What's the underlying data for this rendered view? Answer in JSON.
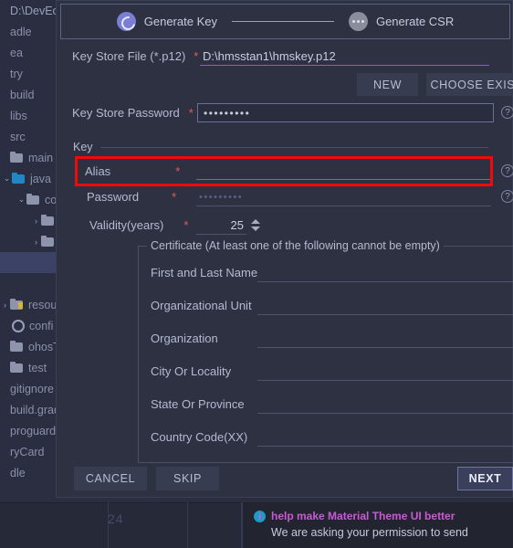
{
  "ide": {
    "tree": [
      {
        "label": "D:\\DevEco",
        "type": "path",
        "indent": 0,
        "arrow": "",
        "selected": false
      },
      {
        "label": "adle",
        "type": "plain",
        "indent": 0,
        "arrow": "",
        "selected": false
      },
      {
        "label": "ea",
        "type": "plain",
        "indent": 0,
        "arrow": "",
        "selected": false
      },
      {
        "label": "try",
        "type": "plain",
        "indent": 0,
        "arrow": "",
        "selected": false
      },
      {
        "label": "build",
        "type": "plain",
        "indent": 0,
        "arrow": "",
        "selected": false
      },
      {
        "label": "libs",
        "type": "plain",
        "indent": 0,
        "arrow": "",
        "selected": false
      },
      {
        "label": "src",
        "type": "plain",
        "indent": 0,
        "arrow": "",
        "selected": false
      },
      {
        "label": "main",
        "type": "folder",
        "indent": 0,
        "arrow": "",
        "selected": false
      },
      {
        "label": "java",
        "type": "folder-blue",
        "indent": 1,
        "arrow": "v",
        "selected": false
      },
      {
        "label": "co",
        "type": "folder",
        "indent": 2,
        "arrow": "v",
        "selected": false
      },
      {
        "label": "",
        "type": "folder",
        "indent": 3,
        "arrow": ">",
        "selected": false
      },
      {
        "label": "",
        "type": "folder",
        "indent": 3,
        "arrow": ">",
        "selected": false
      },
      {
        "label": "",
        "type": "class",
        "indent": 4,
        "arrow": "",
        "selected": true
      },
      {
        "label": "",
        "type": "class",
        "indent": 4,
        "arrow": "",
        "selected": false
      },
      {
        "label": "resou",
        "type": "folder-res",
        "indent": 0,
        "arrow": ">",
        "selected": false
      },
      {
        "label": "confi",
        "type": "gear",
        "indent": 1,
        "arrow": "",
        "selected": false
      },
      {
        "label": "ohosTes",
        "type": "folder",
        "indent": 0,
        "arrow": "",
        "selected": false
      },
      {
        "label": "test",
        "type": "folder",
        "indent": 0,
        "arrow": "",
        "selected": false
      },
      {
        "label": "gitignore",
        "type": "plain",
        "indent": 0,
        "arrow": "",
        "selected": false
      },
      {
        "label": "build.gradl",
        "type": "plain",
        "indent": 0,
        "arrow": "",
        "selected": false
      },
      {
        "label": "proguard-r",
        "type": "plain",
        "indent": 0,
        "arrow": "",
        "selected": false
      },
      {
        "label": "ryCard",
        "type": "plain",
        "indent": 0,
        "arrow": "",
        "selected": false
      },
      {
        "label": "dle",
        "type": "plain",
        "indent": 0,
        "arrow": "",
        "selected": false
      }
    ],
    "editor": {
      "line_number": "24"
    },
    "notification": {
      "title": "help make Material Theme UI better",
      "body": "We are asking your permission to send",
      "icon": "info-icon"
    }
  },
  "dialog": {
    "stepper": {
      "steps": [
        {
          "label": "Generate Key",
          "state": "active",
          "icon": "spinner-circle-icon"
        },
        {
          "label": "Generate CSR",
          "state": "idle",
          "icon": "ellipsis-circle-icon"
        }
      ]
    },
    "key_store_file": {
      "label": "Key Store File (*.p12)",
      "required_marker": "*",
      "value": "D:\\hmsstan1\\hmskey.p12",
      "placeholder": ""
    },
    "buttons": {
      "new": "NEW",
      "choose_existing": "CHOOSE EXISTING"
    },
    "key_store_password": {
      "label": "Key Store Password",
      "required_marker": "*",
      "value": "•••••••••",
      "help_icon": "question-mark-icon"
    },
    "key_group": {
      "title": "Key",
      "alias": {
        "label": "Alias",
        "required_marker": "*",
        "value": "",
        "placeholder": "",
        "highlighted": true,
        "help_icon": "question-mark-icon"
      },
      "password": {
        "label": "Password",
        "required_marker": "*",
        "value": "•••••••••",
        "help_icon": "question-mark-icon"
      },
      "validity": {
        "label": "Validity(years)",
        "required_marker": "*",
        "value": "25"
      }
    },
    "certificate": {
      "legend": "Certificate (At least one of the following cannot be empty)",
      "fields": [
        {
          "label": "First and Last Name",
          "value": ""
        },
        {
          "label": "Organizational Unit",
          "value": ""
        },
        {
          "label": "Organization",
          "value": ""
        },
        {
          "label": "City Or Locality",
          "value": ""
        },
        {
          "label": "State Or Province",
          "value": ""
        },
        {
          "label": "Country Code(XX)",
          "value": ""
        }
      ]
    },
    "footer": {
      "cancel": "CANCEL",
      "skip": "SKIP",
      "next": "NEXT"
    }
  },
  "colors": {
    "dialog_bg": "#2e3142",
    "accent_purple": "#7b7fd4",
    "highlight_red": "#f00a0a",
    "magenta_underline": "#b83fd6",
    "required_red": "#e05c5c",
    "notif_title": "#c45cd4",
    "info_blue": "#1e9bc4"
  }
}
